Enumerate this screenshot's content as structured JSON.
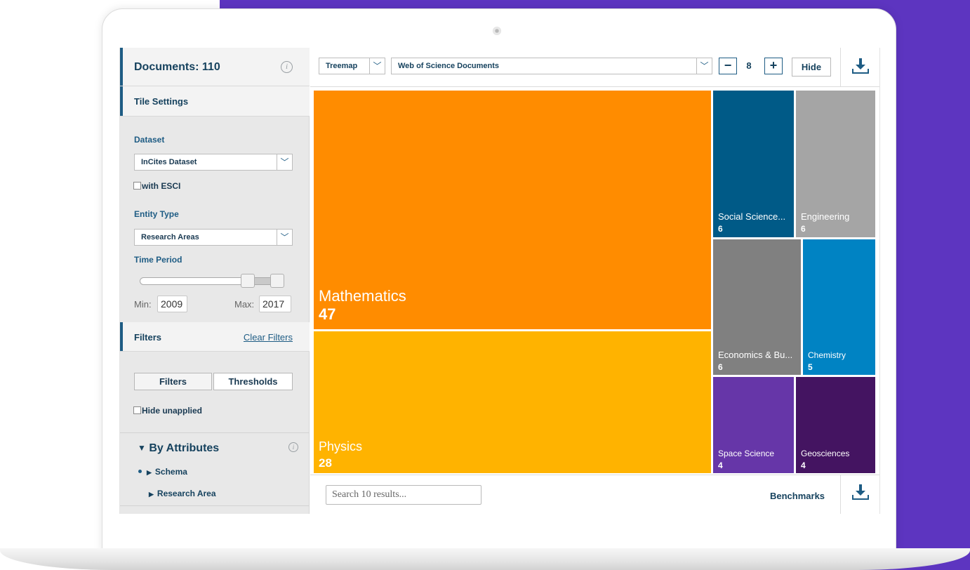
{
  "colors": {
    "background_purple": "#5d35c0",
    "accent_blue": "#1e5c84"
  },
  "sidebar": {
    "documents_label": "Documents: 110",
    "tile_settings_label": "Tile Settings",
    "dataset": {
      "label": "Dataset",
      "selected": "InCites Dataset"
    },
    "with_esci": {
      "label": "with ESCI",
      "checked": false
    },
    "entity_type": {
      "label": "Entity Type",
      "selected": "Research Areas"
    },
    "time_period": {
      "label": "Time Period",
      "min_label": "Min:",
      "min_value": "2009",
      "max_label": "Max:",
      "max_value": "2017"
    },
    "filters_label": "Filters",
    "clear_filters": "Clear Filters",
    "filter_tabs": [
      "Filters",
      "Thresholds"
    ],
    "hide_unapplied": {
      "label": "Hide unapplied",
      "checked": false
    },
    "by_attributes": "By Attributes",
    "attribute_items": [
      "Schema",
      "Research Area"
    ]
  },
  "toolbar": {
    "view_type": "Treemap",
    "source": "Web of Science Documents",
    "minus": "−",
    "count": "8",
    "plus": "+",
    "hide": "Hide"
  },
  "chart_data": {
    "type": "treemap",
    "tiles": [
      {
        "name": "Mathematics",
        "value": 47,
        "color": "#ff8c00"
      },
      {
        "name": "Physics",
        "value": 28,
        "color": "#ffb300"
      },
      {
        "name": "Social Science...",
        "value": 6,
        "color": "#005a87"
      },
      {
        "name": "Engineering",
        "value": 6,
        "color": "#a5a5a5"
      },
      {
        "name": "Economics & Bu...",
        "value": 6,
        "color": "#808080"
      },
      {
        "name": "Chemistry",
        "value": 5,
        "color": "#0083c3"
      },
      {
        "name": "Space Science",
        "value": 4,
        "color": "#6636a8"
      },
      {
        "name": "Geosciences",
        "value": 4,
        "color": "#441461"
      }
    ]
  },
  "bottombar": {
    "search_placeholder": "Search 10 results...",
    "benchmarks": "Benchmarks"
  }
}
